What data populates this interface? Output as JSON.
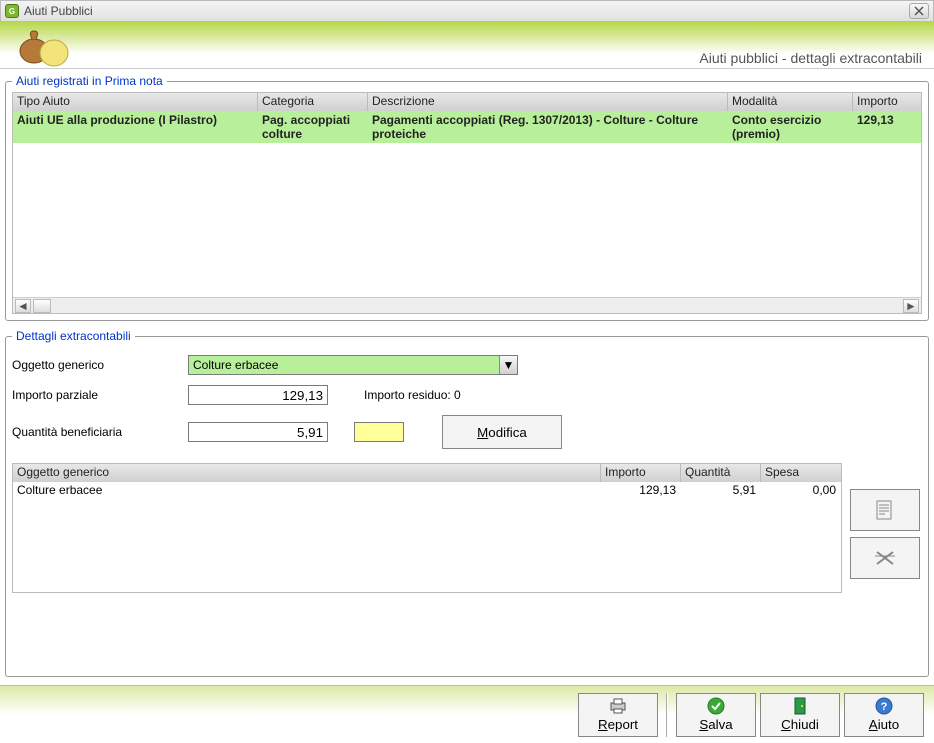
{
  "window": {
    "title": "Aiuti Pubblici"
  },
  "banner": {
    "title": "Aiuti pubblici - dettagli extracontabili"
  },
  "primaNota": {
    "legend": "Aiuti registrati in Prima nota",
    "columns": {
      "tipo": "Tipo Aiuto",
      "categoria": "Categoria",
      "descrizione": "Descrizione",
      "modalita": "Modalità",
      "importo": "Importo"
    },
    "rows": [
      {
        "tipo": "Aiuti UE alla produzione (I Pilastro)",
        "categoria": "Pag. accoppiati colture",
        "descrizione": "Pagamenti accoppiati (Reg. 1307/2013) - Colture - Colture proteiche",
        "modalita": "Conto esercizio (premio)",
        "importo": "129,13"
      }
    ]
  },
  "dettagli": {
    "legend": "Dettagli extracontabili",
    "labels": {
      "oggetto": "Oggetto generico",
      "importoParziale": "Importo parziale",
      "quantita": "Quantità beneficiaria",
      "residuoPrefix": "Importo residuo: ",
      "residuo": "0"
    },
    "values": {
      "oggetto": "Colture erbacee",
      "importoParziale": "129,13",
      "quantita": "5,91",
      "unit": ""
    },
    "modifica": "Modifica",
    "grid": {
      "columns": {
        "oggetto": "Oggetto generico",
        "importo": "Importo",
        "quantita": "Quantità",
        "spesa": "Spesa"
      },
      "rows": [
        {
          "oggetto": "Colture erbacee",
          "importo": "129,13",
          "quantita": "5,91",
          "spesa": "0,00"
        }
      ]
    }
  },
  "footer": {
    "report": "Report",
    "salva": "Salva",
    "chiudi": "Chiudi",
    "aiuto": "Aiuto"
  }
}
